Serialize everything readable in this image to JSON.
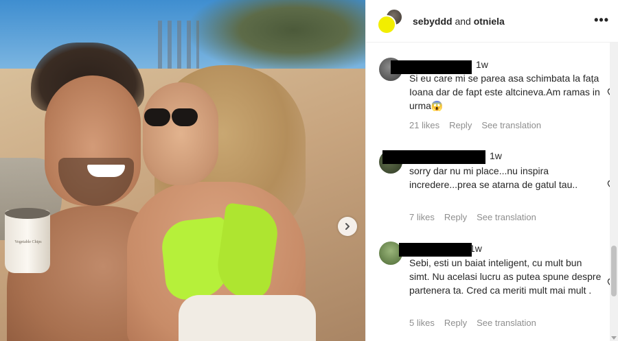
{
  "header": {
    "user1": "sebyddd",
    "conjunction": "and",
    "user2": "otniela",
    "more_icon": "•••"
  },
  "photo": {
    "cup_label": "Vegetable Chips",
    "next_icon": "chevron-right-icon"
  },
  "comments": [
    {
      "time": "1w",
      "text": "Si eu care mi se parea asa schimbata la fața Ioana dar de fapt este altcineva.Am ramas in urma😱",
      "likes": "21 likes",
      "reply": "Reply",
      "translate": "See translation"
    },
    {
      "time": "1w",
      "text": "sorry dar nu mi place...nu inspira incredere...prea se atarna de gatul tau..",
      "likes": "7 likes",
      "reply": "Reply",
      "translate": "See translation"
    },
    {
      "time": "1w",
      "text": "Sebi, esti un baiat inteligent, cu mult bun simt. Nu acelasi lucru as putea spune despre partenera ta. Cred ca meriti mult mai mult .",
      "likes": "5 likes",
      "reply": "Reply",
      "translate": "See translation"
    }
  ],
  "colors": {
    "text": "#262626",
    "meta": "#8e8e8e",
    "border": "#efefef",
    "highlight_avatar": "#f2ee00",
    "bikini": "#b6f03a"
  }
}
